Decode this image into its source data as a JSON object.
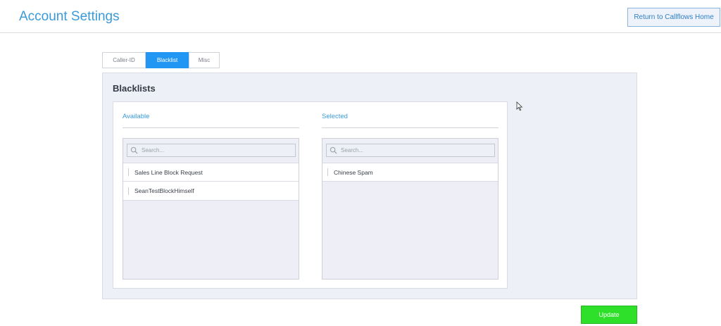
{
  "header": {
    "title": "Account Settings",
    "return_label": "Return to Callflows Home"
  },
  "tabs": [
    {
      "label": "Caller-ID",
      "active": false
    },
    {
      "label": "Blacklist",
      "active": true
    },
    {
      "label": "Misc",
      "active": false
    }
  ],
  "panel": {
    "title": "Blacklists",
    "available": {
      "heading": "Available",
      "search_placeholder": "Search...",
      "items": [
        "Sales Line Block Request",
        "SeanTestBlockHimself"
      ]
    },
    "selected": {
      "heading": "Selected",
      "search_placeholder": "Search...",
      "items": [
        "Chinese Spam"
      ]
    }
  },
  "actions": {
    "update_label": "Update"
  },
  "colors": {
    "accent": "#3a9ad9",
    "active_tab": "#2196f3",
    "update_button": "#2ee02a"
  }
}
